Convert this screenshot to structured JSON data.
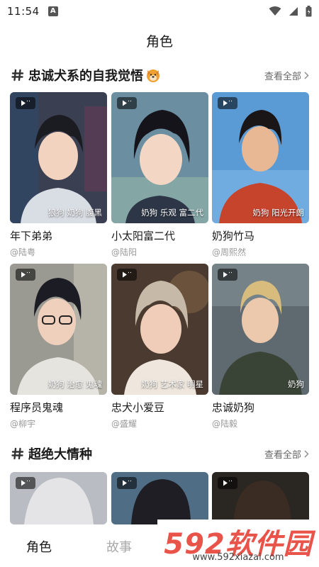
{
  "status_bar": {
    "time": "11:54",
    "notif_letter": "A"
  },
  "page": {
    "title": "角色"
  },
  "sections": [
    {
      "title": "忠诚犬系的自我觉悟",
      "view_all": "查看全部",
      "cards": [
        {
          "name": "年下弟弟",
          "author": "@陆粤",
          "tags": "狼狗 奶狗 腹黑"
        },
        {
          "name": "小太阳富二代",
          "author": "@陆阳",
          "tags": "奶狗 乐观 富二代"
        },
        {
          "name": "奶狗竹马",
          "author": "@周熙然",
          "tags": "奶狗 阳光开朗"
        },
        {
          "name": "程序员鬼魂",
          "author": "@柳宇",
          "tags": "奶狗 治愈 鬼魂"
        },
        {
          "name": "忠犬小爱豆",
          "author": "@盛耀",
          "tags": "奶狗 艺术家 明星"
        },
        {
          "name": "忠诚奶狗",
          "author": "@陆毅",
          "tags": "奶狗"
        }
      ]
    },
    {
      "title": "超绝大情种",
      "view_all": "查看全部",
      "cards": []
    }
  ],
  "bottom_nav": {
    "items": [
      "角色",
      "故事"
    ],
    "active": "角色"
  },
  "watermark": {
    "text": "592软件园",
    "url": "www.592xiazai.com"
  },
  "colors": {
    "accent": "#e8534a",
    "muted": "#999999"
  }
}
